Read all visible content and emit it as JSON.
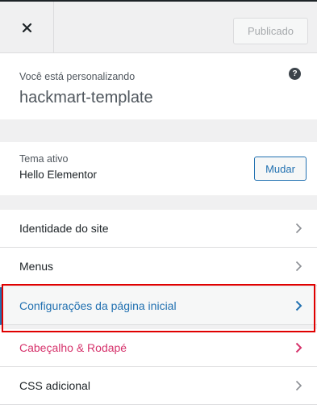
{
  "header": {
    "close_icon": "close-icon",
    "publish_label": "Publicado"
  },
  "info": {
    "label": "Você está personalizando",
    "title": "hackmart-template",
    "help_icon": "?"
  },
  "theme": {
    "label": "Tema ativo",
    "name": "Hello Elementor",
    "change_label": "Mudar"
  },
  "menu": {
    "items": [
      {
        "label": "Identidade do site",
        "state": "normal"
      },
      {
        "label": "Menus",
        "state": "normal"
      },
      {
        "label": "Configurações da página inicial",
        "state": "active"
      },
      {
        "label": "Cabeçalho & Rodapé",
        "state": "highlight"
      },
      {
        "label": "CSS adicional",
        "state": "normal"
      }
    ]
  },
  "colors": {
    "accent": "#2271b1",
    "highlight_text": "#d6336c",
    "annotation_border": "#e00000"
  }
}
